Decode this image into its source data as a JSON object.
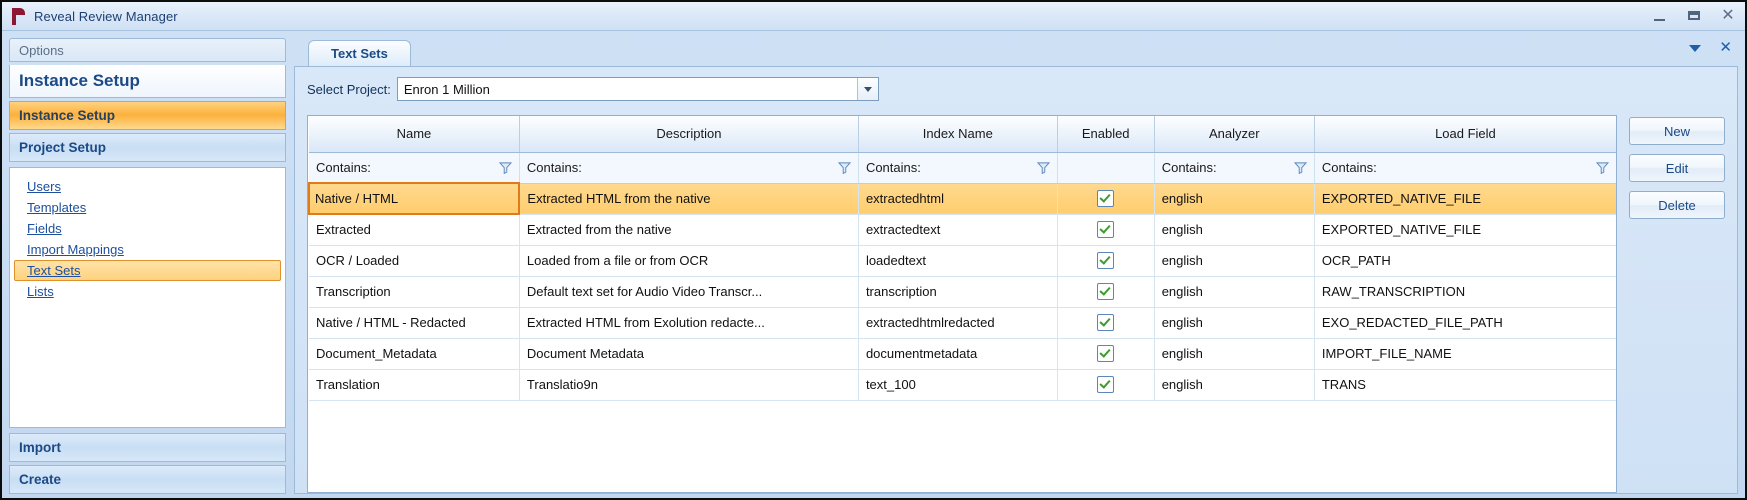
{
  "window": {
    "title": "Reveal Review Manager",
    "logo": "reveal-r-logo",
    "controls": {
      "minimize": "minimize-icon",
      "maximize": "maximize-icon",
      "close": "✕"
    }
  },
  "sidebar": {
    "options_label": "Options",
    "panel_title": "Instance Setup",
    "sections": [
      {
        "label": "Instance Setup",
        "active": true
      },
      {
        "label": "Project Setup",
        "active": false
      },
      {
        "label": "Import",
        "active": false
      },
      {
        "label": "Create",
        "active": false
      }
    ],
    "links": [
      {
        "label": "Users",
        "selected": false
      },
      {
        "label": "Templates",
        "selected": false
      },
      {
        "label": "Fields",
        "selected": false
      },
      {
        "label": "Import Mappings",
        "selected": false
      },
      {
        "label": "Text Sets",
        "selected": true
      },
      {
        "label": "Lists",
        "selected": false
      }
    ]
  },
  "tab_panel": {
    "tab_label": "Text Sets",
    "dropdown_icon": "chevron-down-icon",
    "close_icon": "✕"
  },
  "project": {
    "label": "Select Project:",
    "value": "Enron 1 Million",
    "dropdown_icon": "chevron-down-icon"
  },
  "grid": {
    "columns": [
      {
        "key": "name",
        "header": "Name",
        "filterable": true
      },
      {
        "key": "description",
        "header": "Description",
        "filterable": true
      },
      {
        "key": "index_name",
        "header": "Index Name",
        "filterable": true
      },
      {
        "key": "enabled",
        "header": "Enabled",
        "filterable": false
      },
      {
        "key": "analyzer",
        "header": "Analyzer",
        "filterable": true
      },
      {
        "key": "load_field",
        "header": "Load Field",
        "filterable": true
      }
    ],
    "filter_placeholder": "Contains:",
    "filter_icon": "funnel-icon",
    "rows": [
      {
        "name": "Native / HTML",
        "description": "Extracted HTML from the native",
        "index_name": "extractedhtml",
        "enabled": true,
        "analyzer": "english",
        "load_field": "EXPORTED_NATIVE_FILE",
        "selected": true
      },
      {
        "name": "Extracted",
        "description": "Extracted from the native",
        "index_name": "extractedtext",
        "enabled": true,
        "analyzer": "english",
        "load_field": "EXPORTED_NATIVE_FILE",
        "selected": false
      },
      {
        "name": "OCR / Loaded",
        "description": "Loaded from a file or from OCR",
        "index_name": "loadedtext",
        "enabled": true,
        "analyzer": "english",
        "load_field": "OCR_PATH",
        "selected": false
      },
      {
        "name": "Transcription",
        "description": "Default text set for Audio Video Transcr...",
        "index_name": "transcription",
        "enabled": true,
        "analyzer": "english",
        "load_field": "RAW_TRANSCRIPTION",
        "selected": false
      },
      {
        "name": "Native / HTML - Redacted",
        "description": "Extracted HTML from Exolution redacte...",
        "index_name": "extractedhtmlredacted",
        "enabled": true,
        "analyzer": "english",
        "load_field": "EXO_REDACTED_FILE_PATH",
        "selected": false
      },
      {
        "name": "Document_Metadata",
        "description": "Document Metadata",
        "index_name": "documentmetadata",
        "enabled": true,
        "analyzer": "english",
        "load_field": "IMPORT_FILE_NAME",
        "selected": false
      },
      {
        "name": "Translation",
        "description": "Translatio9n",
        "index_name": "text_100",
        "enabled": true,
        "analyzer": "english",
        "load_field": "TRANS",
        "selected": false
      }
    ]
  },
  "actions": [
    {
      "label": "New"
    },
    {
      "label": "Edit"
    },
    {
      "label": "Delete"
    }
  ],
  "colors": {
    "accent_orange": "#ffcd6d",
    "accent_orange_border": "#e07b1c",
    "title_blue": "#1b4a87",
    "logo_red": "#8c1834"
  }
}
